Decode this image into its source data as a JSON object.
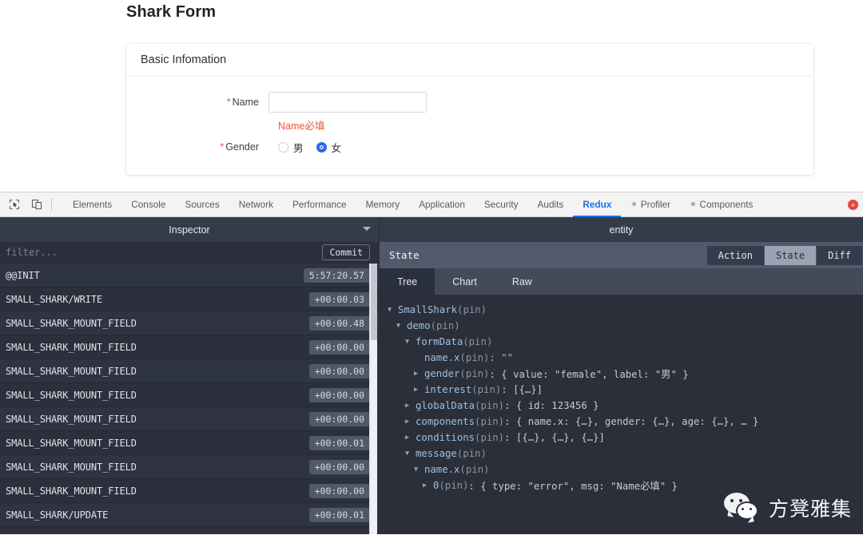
{
  "page": {
    "title": "Shark Form",
    "card": {
      "header": "Basic Infomation",
      "fields": {
        "name": {
          "label": "Name",
          "required_mark": "*",
          "value": "",
          "placeholder": "",
          "error": "Name必填"
        },
        "gender": {
          "label": "Gender",
          "required_mark": "*",
          "options": [
            {
              "label": "男",
              "checked": false
            },
            {
              "label": "女",
              "checked": true
            }
          ]
        }
      }
    }
  },
  "devtools": {
    "icons": [
      {
        "name": "inspect-element-icon"
      },
      {
        "name": "device-toolbar-icon"
      }
    ],
    "tabs": [
      {
        "label": "Elements",
        "active": false,
        "star": false
      },
      {
        "label": "Console",
        "active": false,
        "star": false
      },
      {
        "label": "Sources",
        "active": false,
        "star": false
      },
      {
        "label": "Network",
        "active": false,
        "star": false
      },
      {
        "label": "Performance",
        "active": false,
        "star": false
      },
      {
        "label": "Memory",
        "active": false,
        "star": false
      },
      {
        "label": "Application",
        "active": false,
        "star": false
      },
      {
        "label": "Security",
        "active": false,
        "star": false
      },
      {
        "label": "Audits",
        "active": false,
        "star": false
      },
      {
        "label": "Redux",
        "active": true,
        "star": false
      },
      {
        "label": "Profiler",
        "active": false,
        "star": true
      },
      {
        "label": "Components",
        "active": false,
        "star": true
      }
    ],
    "error_badge": "×"
  },
  "redux": {
    "header": {
      "inspector_title": "Inspector",
      "entity_title": "entity"
    },
    "filter": {
      "placeholder": "filter...",
      "value": "",
      "commit_label": "Commit"
    },
    "actions": [
      {
        "name": "@@INIT",
        "time": "5:57:20.57"
      },
      {
        "name": "SMALL_SHARK/WRITE",
        "time": "+00:00.03"
      },
      {
        "name": "SMALL_SHARK_MOUNT_FIELD",
        "time": "+00:00.48"
      },
      {
        "name": "SMALL_SHARK_MOUNT_FIELD",
        "time": "+00:00.00"
      },
      {
        "name": "SMALL_SHARK_MOUNT_FIELD",
        "time": "+00:00.00"
      },
      {
        "name": "SMALL_SHARK_MOUNT_FIELD",
        "time": "+00:00.00"
      },
      {
        "name": "SMALL_SHARK_MOUNT_FIELD",
        "time": "+00:00.00"
      },
      {
        "name": "SMALL_SHARK_MOUNT_FIELD",
        "time": "+00:00.01"
      },
      {
        "name": "SMALL_SHARK_MOUNT_FIELD",
        "time": "+00:00.00"
      },
      {
        "name": "SMALL_SHARK_MOUNT_FIELD",
        "time": "+00:00.00"
      },
      {
        "name": "SMALL_SHARK/UPDATE",
        "time": "+00:00.01"
      }
    ],
    "state_panel": {
      "title": "State",
      "segments": [
        {
          "label": "Action",
          "active": false
        },
        {
          "label": "State",
          "active": true
        },
        {
          "label": "Diff",
          "active": false
        }
      ],
      "subtabs": [
        {
          "label": "Tree",
          "active": true
        },
        {
          "label": "Chart",
          "active": false
        },
        {
          "label": "Raw",
          "active": false
        }
      ],
      "tree": [
        {
          "indent": 0,
          "arrow": "down",
          "key": "SmallShark",
          "pin": " (pin)",
          "value": ""
        },
        {
          "indent": 1,
          "arrow": "down",
          "key": "demo",
          "pin": " (pin)",
          "value": ""
        },
        {
          "indent": 2,
          "arrow": "down",
          "key": "formData",
          "pin": " (pin)",
          "value": ""
        },
        {
          "indent": 3,
          "arrow": "none",
          "key": "name.x",
          "pin": " (pin)",
          "value": ": \"\""
        },
        {
          "indent": 3,
          "arrow": "right",
          "key": "gender",
          "pin": " (pin)",
          "value": ": { value: \"female\", label: \"男\" }"
        },
        {
          "indent": 3,
          "arrow": "right",
          "key": "interest",
          "pin": " (pin)",
          "value": ": [{…}]"
        },
        {
          "indent": 2,
          "arrow": "right",
          "key": "globalData",
          "pin": " (pin)",
          "value": ": { id: 123456 }"
        },
        {
          "indent": 2,
          "arrow": "right",
          "key": "components",
          "pin": " (pin)",
          "value": ": { name.x: {…}, gender: {…}, age: {…}, … }"
        },
        {
          "indent": 2,
          "arrow": "right",
          "key": "conditions",
          "pin": " (pin)",
          "value": ": [{…}, {…}, {…}]"
        },
        {
          "indent": 2,
          "arrow": "down",
          "key": "message",
          "pin": " (pin)",
          "value": ""
        },
        {
          "indent": 3,
          "arrow": "down",
          "key": "name.x",
          "pin": " (pin)",
          "value": ""
        },
        {
          "indent": 4,
          "arrow": "right",
          "key": "0",
          "pin": " (pin)",
          "value": ": { type: \"error\", msg: \"Name必填\" }"
        }
      ]
    }
  },
  "watermark": {
    "text": "方凳雅集",
    "icon": "wechat-icon"
  },
  "colors": {
    "accent_blue": "#2c62f0",
    "error_red": "#e8543f",
    "devtools_active_tab": "#1a73e8",
    "redux_bg": "#2a2f3a",
    "redux_header_bg": "#343b4a",
    "state_topbar_bg": "#515a6b"
  }
}
